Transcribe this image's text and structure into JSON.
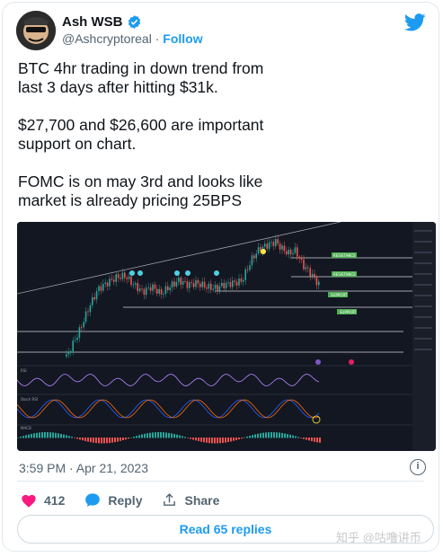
{
  "author": {
    "name": "Ash WSB",
    "handle": "@Ashcryptoreal",
    "separator": "·",
    "follow_label": "Follow"
  },
  "tweet": {
    "paragraphs": [
      "BTC 4hr trading in down trend from last 3 days after hitting $31k.",
      "$27,700 and $26,600 are important support on chart.",
      "FOMC is on may 3rd and looks like market is already pricing 25BPS"
    ],
    "timestamp": "3:59 PM · Apr 21, 2023"
  },
  "chart_image": {
    "labels": [
      "RESISTANCE",
      "RESISTANCE",
      "SUPPORT",
      "SUPPORT"
    ],
    "panel_labels": [
      "RSI",
      "Stoch RSI",
      "MACD"
    ]
  },
  "actions": {
    "likes": "412",
    "reply_label": "Reply",
    "share_label": "Share"
  },
  "read_replies_label": "Read 65 replies",
  "watermark": "知乎 @咕噜讲币",
  "colors": {
    "accent": "#1d9bf0",
    "like": "#f91880",
    "chart_bg": "#131722",
    "label_green": "#4caf50"
  }
}
